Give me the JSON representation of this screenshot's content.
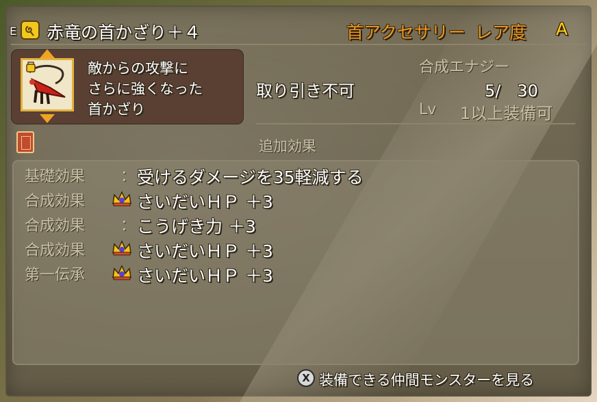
{
  "header": {
    "equip_marker": "E",
    "item_name": "赤竜の首かざり＋４",
    "category": "首アクセサリー",
    "rarity_label": "レア度",
    "rarity_value": "A"
  },
  "description": {
    "lines": [
      "敵からの攻撃に",
      "さらに強くなった",
      "首かざり"
    ]
  },
  "stats": {
    "trade_status": "取り引き不可",
    "synthesis_label": "合成エナジー",
    "synthesis_value": "5/　30",
    "level_label": "Lv",
    "level_value": "1以上装備可"
  },
  "effects": {
    "title": "追加効果",
    "rows": [
      {
        "label": "基礎効果",
        "separator": "：",
        "text": "受けるダメージを35軽減する",
        "icon": null
      },
      {
        "label": "合成効果",
        "separator": "",
        "text": "さいだいＨＰ ＋3",
        "icon": "crown-icon"
      },
      {
        "label": "合成効果",
        "separator": "：",
        "text": "こうげき力 ＋3",
        "icon": null
      },
      {
        "label": "合成効果",
        "separator": "",
        "text": "さいだいＨＰ ＋3",
        "icon": "crown-icon"
      },
      {
        "label": "第一伝承",
        "separator": "",
        "text": "さいだいＨＰ ＋3",
        "icon": "crown-icon"
      }
    ]
  },
  "footer": {
    "button_glyph": "X",
    "label": "装備できる仲間モンスターを見る"
  },
  "colors": {
    "accent_gold": "#e89a2a",
    "rarity_yellow": "#ffd21f",
    "text_white": "#ffffff",
    "text_dim": "#c9c0a6",
    "desc_box": "#5a3f33"
  }
}
